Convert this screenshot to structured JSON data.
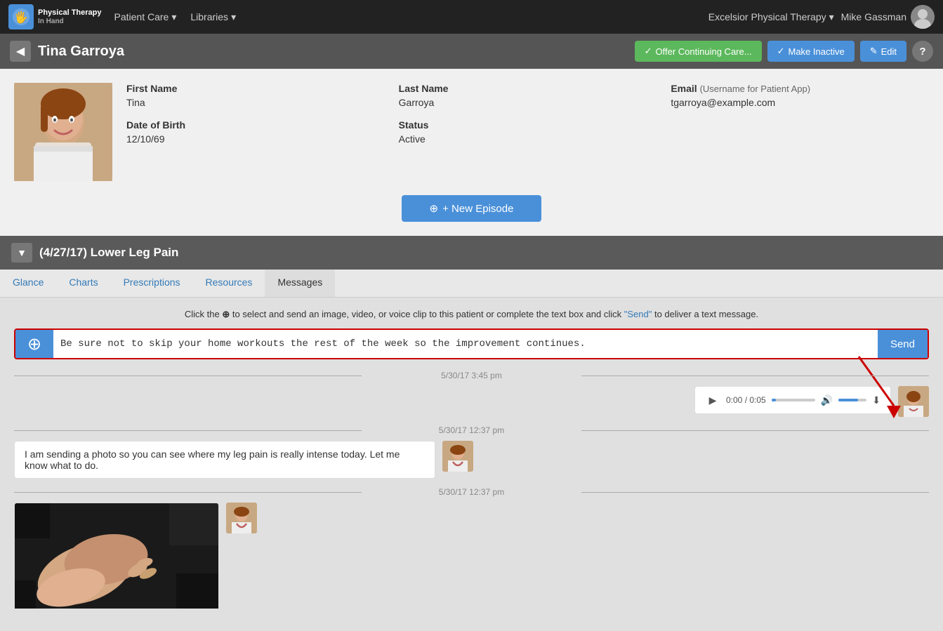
{
  "app": {
    "brand": "Physical Therapy\nIn Hand",
    "nav_items": [
      {
        "label": "Patient Care",
        "has_dropdown": true
      },
      {
        "label": "Libraries",
        "has_dropdown": true
      }
    ],
    "clinic_name": "Excelsior Physical Therapy",
    "user_name": "Mike Gassman"
  },
  "patient": {
    "name": "Tina Garroya",
    "first_name": "Tina",
    "last_name": "Garroya",
    "dob": "12/10/69",
    "status": "Active",
    "email_label": "Email",
    "email_sublabel": "(Username for Patient App)",
    "email": "tgarroya@example.com"
  },
  "actions": {
    "offer_continuing_care": "Offer Continuing Care...",
    "make_inactive": "Make Inactive",
    "edit": "Edit"
  },
  "episode": {
    "title": "(4/27/17) Lower Leg Pain"
  },
  "tabs": [
    {
      "label": "Glance",
      "active": false
    },
    {
      "label": "Charts",
      "active": false
    },
    {
      "label": "Prescriptions",
      "active": false
    },
    {
      "label": "Resources",
      "active": false
    },
    {
      "label": "Messages",
      "active": true
    }
  ],
  "messages": {
    "instruction": "Click the ⊕ to select and send an image, video, or voice clip to this patient or complete the text box and click “Send” to deliver a text message.",
    "compose_placeholder": "Be sure not to skip your home workouts the rest of the week so the improvement continues.",
    "send_label": "Send",
    "new_episode_label": "+ New Episode",
    "thread": [
      {
        "timestamp": "5/30/17 3:45 pm",
        "type": "audio",
        "from": "therapist",
        "duration": "0:05",
        "current_time": "0:00"
      },
      {
        "timestamp": "5/30/17 12:37 pm",
        "type": "text",
        "from": "patient",
        "text": "I am sending a photo so you can see where my leg pain is really intense today. Let me know what to do."
      },
      {
        "timestamp": "5/30/17 12:37 pm",
        "type": "image",
        "from": "patient"
      }
    ]
  }
}
